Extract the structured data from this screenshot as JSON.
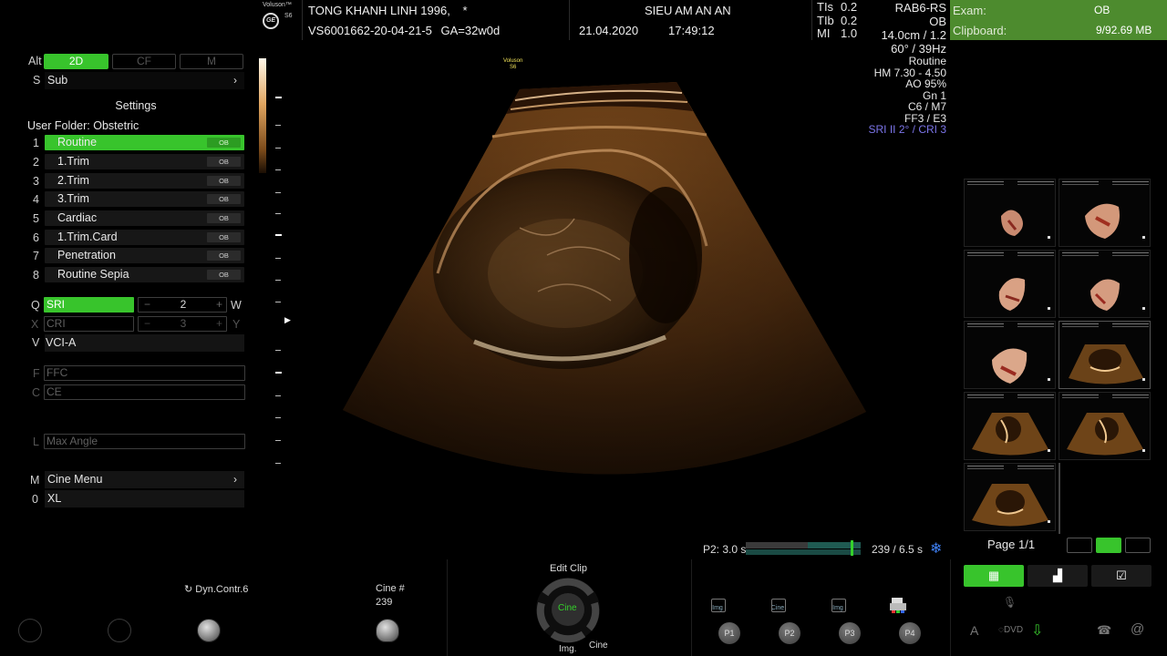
{
  "header": {
    "brand": "Voluson™",
    "model": "S6",
    "patient_name": "TONG KHANH LINH 1996,",
    "patient_flag": "*",
    "patient_id": "VS6001662-20-04-21-5",
    "ga": "GA=32w0d",
    "institution": "SIEU AM AN AN",
    "date": "21.04.2020",
    "time": "17:49:12",
    "tis_label": "TIs",
    "tis_value": "0.2",
    "tib_label": "TIb",
    "tib_value": "0.2",
    "mi_label": "MI",
    "mi_value": "1.0"
  },
  "probe_info": {
    "probe": "RAB6-RS",
    "app": "OB",
    "depth": "14.0cm / 1.2",
    "angle": "60° / 39Hz",
    "preset": "Routine",
    "hm": "HM  7.30 - 4.50",
    "ao": "AO 95%",
    "gn": "Gn  1",
    "c": "C6 / M7",
    "ff": "FF3 / E3",
    "sri": "SRI II 2° / CRI 3"
  },
  "exam_box": {
    "exam_label": "Exam:",
    "exam_value": "OB",
    "clipboard_label": "Clipboard:",
    "clipboard_value": "9/92.69 MB"
  },
  "left_panel": {
    "alt_label": "Alt",
    "tabs": [
      "2D",
      "CF",
      "M"
    ],
    "s_key": "S",
    "sub_label": "Sub",
    "settings_title": "Settings",
    "user_folder": "User Folder: Obstetric",
    "presets": [
      {
        "num": "1",
        "name": "Routine",
        "tag": "OB"
      },
      {
        "num": "2",
        "name": "1.Trim",
        "tag": "OB"
      },
      {
        "num": "3",
        "name": "2.Trim",
        "tag": "OB"
      },
      {
        "num": "4",
        "name": "3.Trim",
        "tag": "OB"
      },
      {
        "num": "5",
        "name": "Cardiac",
        "tag": "OB"
      },
      {
        "num": "6",
        "name": "1.Trim.Card",
        "tag": "OB"
      },
      {
        "num": "7",
        "name": "Penetration",
        "tag": "OB"
      },
      {
        "num": "8",
        "name": "Routine Sepia",
        "tag": "OB"
      }
    ],
    "q_key": "Q",
    "sri_label": "SRI",
    "sri_value": "2",
    "w_key": "W",
    "x_key": "X",
    "cri_label": "CRI",
    "cri_value": "3",
    "y_key": "Y",
    "v_key": "V",
    "vci_label": "VCI-A",
    "f_key": "F",
    "ffc_label": "FFC",
    "c_key": "C",
    "ce_label": "CE",
    "l_key": "L",
    "max_angle_label": "Max Angle",
    "m_key": "M",
    "cine_menu_label": "Cine Menu",
    "zero_key": "0",
    "xl_label": "XL"
  },
  "scan_label": {
    "line1": "Voluson",
    "line2": "S6"
  },
  "right_panel": {
    "page_label": "Page 1/1"
  },
  "bottom": {
    "cine_p2": "P2:  3.0 s",
    "cine_count": "239 / 6.5 s",
    "cine_progress": 0.92,
    "dyn_contr": "Dyn.Contr.6",
    "cine_num_label": "Cine #",
    "cine_num_value": "239",
    "edit_clip": "Edit Clip",
    "cine_center": "Cine",
    "img_label": "Img.",
    "cine_label": "Cine",
    "p_buttons": [
      "P1",
      "P2",
      "P3",
      "P4"
    ],
    "img_icon_text": "Img",
    "cine_icon_text": "Cine"
  },
  "colors": {
    "accent_green": "#38c42c",
    "exam_green": "#4d8b2e",
    "sri_purple": "#7b74e8"
  }
}
